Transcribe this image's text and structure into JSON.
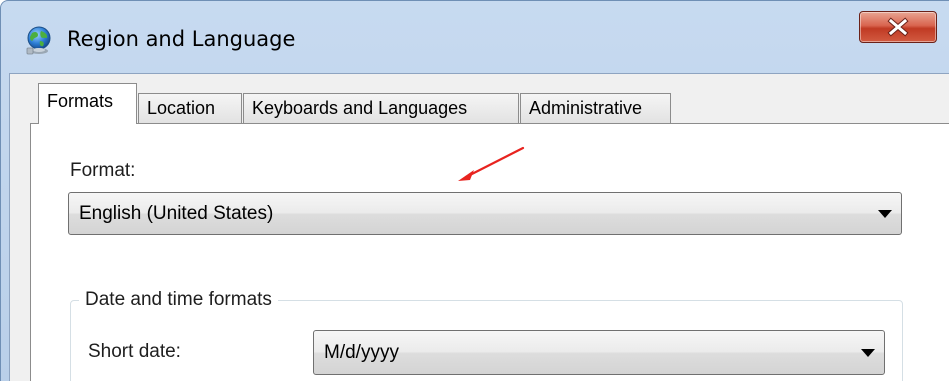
{
  "window": {
    "title": "Region and Language",
    "app_icon": "globe-icon",
    "close_icon": "close-icon"
  },
  "tabs": [
    {
      "label": "Formats",
      "active": true
    },
    {
      "label": "Location",
      "active": false
    },
    {
      "label": "Keyboards and Languages",
      "active": false
    },
    {
      "label": "Administrative",
      "active": false
    }
  ],
  "formats": {
    "format_label": "Format:",
    "format_value": "English (United States)",
    "group_title": "Date and time formats",
    "short_date_label": "Short date:",
    "short_date_value": "M/d/yyyy"
  },
  "colors": {
    "annotation_arrow": "#e8231f",
    "close_button": "#c7442e"
  },
  "icons": {
    "dropdown": "chevron-down-icon",
    "annotation": "arrow-icon"
  }
}
